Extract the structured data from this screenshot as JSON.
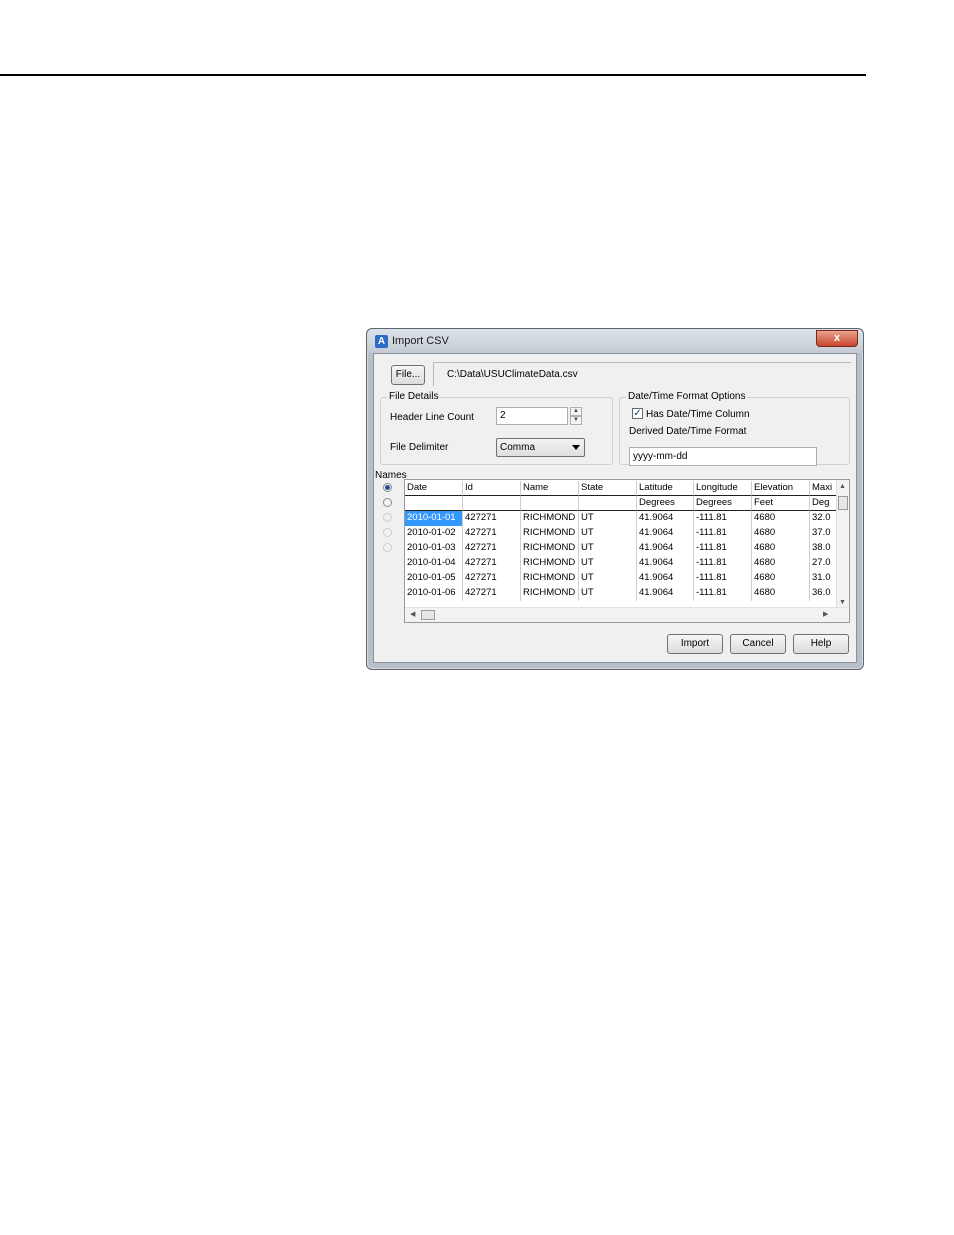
{
  "dialog": {
    "title": "Import CSV",
    "close_symbol": "x",
    "app_icon_symbol": "A"
  },
  "file": {
    "button_label": "File...",
    "path": "C:\\Data\\USUClimateData.csv"
  },
  "file_details": {
    "group_label": "File Details",
    "header_line_label": "Header Line Count",
    "header_line_value": "2",
    "delimiter_label": "File Delimiter",
    "delimiter_value": "Comma"
  },
  "datetime": {
    "group_label": "Date/Time Format Options",
    "has_column_label": "Has Date/Time Column",
    "has_column_checked": true,
    "check_mark": "✓",
    "derived_label": "Derived Date/Time Format",
    "derived_value": "yyyy-mm-dd"
  },
  "names_label": "Names",
  "table": {
    "headers": [
      "Date",
      "Id",
      "Name",
      "State",
      "Latitude",
      "Longitude",
      "Elevation",
      "Maxi"
    ],
    "units": [
      "",
      "",
      "",
      "",
      "Degrees",
      "Degrees",
      "Feet",
      "Deg"
    ],
    "rows": [
      [
        "2010-01-01",
        "427271",
        "RICHMOND",
        "UT",
        "41.9064",
        "-111.81",
        "4680",
        "32.0"
      ],
      [
        "2010-01-02",
        "427271",
        "RICHMOND",
        "UT",
        "41.9064",
        "-111.81",
        "4680",
        "37.0"
      ],
      [
        "2010-01-03",
        "427271",
        "RICHMOND",
        "UT",
        "41.9064",
        "-111.81",
        "4680",
        "38.0"
      ],
      [
        "2010-01-04",
        "427271",
        "RICHMOND",
        "UT",
        "41.9064",
        "-111.81",
        "4680",
        "27.0"
      ],
      [
        "2010-01-05",
        "427271",
        "RICHMOND",
        "UT",
        "41.9064",
        "-111.81",
        "4680",
        "31.0"
      ],
      [
        "2010-01-06",
        "427271",
        "RICHMOND",
        "UT",
        "41.9064",
        "-111.81",
        "4680",
        "36.0"
      ]
    ]
  },
  "buttons": {
    "import": "Import",
    "cancel": "Cancel",
    "help": "Help"
  },
  "colors": {
    "selection": "#3399ff",
    "close_button": "#c8452b"
  }
}
